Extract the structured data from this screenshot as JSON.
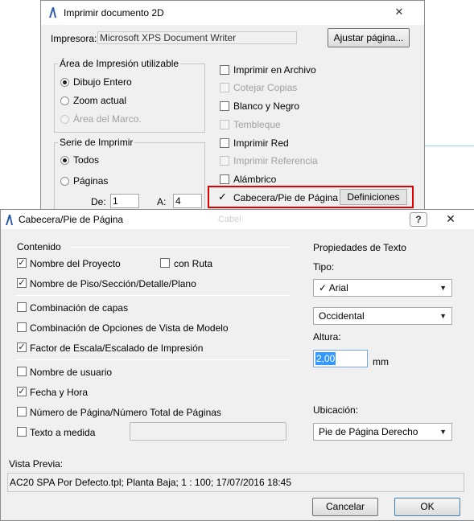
{
  "print_window": {
    "title": "Imprimir documento 2D",
    "close_glyph": "✕",
    "printer_label": "Impresora:",
    "printer_value": "Microsoft XPS Document Writer",
    "adjust_page_button": "Ajustar página...",
    "area_group": {
      "title": "Área de Impresión utilizable",
      "options": [
        {
          "label": "Dibujo Entero",
          "selected": true,
          "enabled": true
        },
        {
          "label": "Zoom actual",
          "selected": false,
          "enabled": true
        },
        {
          "label": "Área del Marco.",
          "selected": false,
          "enabled": false
        }
      ]
    },
    "serie_group": {
      "title": "Serie de Imprimir",
      "options": [
        {
          "label": "Todos",
          "selected": true
        },
        {
          "label": "Páginas",
          "selected": false
        }
      ],
      "from_label": "De:",
      "from_value": "1",
      "to_label": "A:",
      "to_value": "4"
    },
    "checkboxes": [
      {
        "label": "Imprimir en Archivo",
        "checked": false,
        "enabled": true
      },
      {
        "label": "Cotejar Copias",
        "checked": false,
        "enabled": false
      },
      {
        "label": "Blanco y Negro",
        "checked": false,
        "enabled": true
      },
      {
        "label": "Tembleque",
        "checked": false,
        "enabled": false
      },
      {
        "label": "Imprimir Red",
        "checked": false,
        "enabled": true
      },
      {
        "label": "Imprimir Referencia",
        "checked": false,
        "enabled": false
      },
      {
        "label": "Alámbrico",
        "checked": false,
        "enabled": true
      }
    ],
    "header_footer_checkbox": {
      "label": "Cabecera/Pie de Página",
      "checked": true
    },
    "definitions_button": "Definiciones"
  },
  "hf_dialog": {
    "title": "Cabecera/Pie de Página",
    "ghost_text": "Cabel",
    "help_glyph": "?",
    "close_glyph": "✕",
    "content_title": "Contenido",
    "items": {
      "project_name": {
        "label": "Nombre del Proyecto",
        "checked": true
      },
      "with_path": {
        "label": "con Ruta",
        "checked": false
      },
      "floor_name": {
        "label": "Nombre de Piso/Sección/Detalle/Plano",
        "checked": true
      },
      "layer_combo": {
        "label": "Combinación de capas",
        "checked": false
      },
      "model_view": {
        "label": "Combinación de Opciones de Vista de Modelo",
        "checked": false
      },
      "scale": {
        "label": "Factor de Escala/Escalado de Impresión",
        "checked": true
      },
      "user_name": {
        "label": "Nombre de usuario",
        "checked": false
      },
      "date_time": {
        "label": "Fecha y Hora",
        "checked": true
      },
      "page_number": {
        "label": "Número de Página/Número Total de Páginas",
        "checked": false
      },
      "custom_text": {
        "label": "Texto a medida",
        "checked": false
      }
    },
    "text_props": {
      "title": "Propiedades de Texto",
      "type_label": "Tipo:",
      "font": "Arial",
      "font_check": "✓",
      "script": "Occidental",
      "height_label": "Altura:",
      "height_value": "2,00",
      "height_unit": "mm",
      "location_label": "Ubicación:",
      "location_value": "Pie de Página Derecho"
    },
    "preview_label": "Vista Previa:",
    "preview_value": "AC20 SPA Por Defecto.tpl; Planta Baja; 1 : 100; 17/07/2016 18:45",
    "cancel_button": "Cancelar",
    "ok_button": "OK"
  }
}
